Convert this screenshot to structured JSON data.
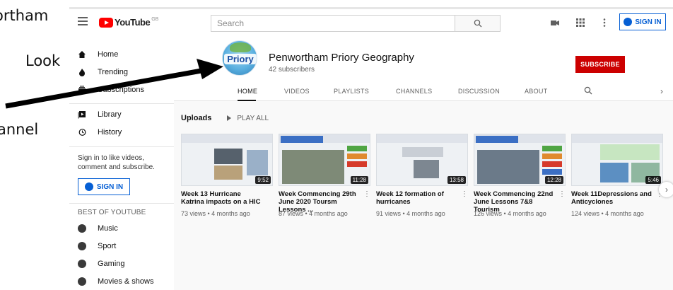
{
  "annotations": {
    "line1": "ortham",
    "line2": "Look",
    "line3": "annel"
  },
  "header": {
    "logo_text": "YouTube",
    "logo_region": "GB",
    "search_placeholder": "Search",
    "signin_label": "SIGN IN"
  },
  "sidebar": {
    "items": [
      {
        "label": "Home",
        "icon": "home-icon"
      },
      {
        "label": "Trending",
        "icon": "trending-icon"
      },
      {
        "label": "Subscriptions",
        "icon": "subscriptions-icon"
      },
      {
        "label": "Library",
        "icon": "library-icon"
      },
      {
        "label": "History",
        "icon": "history-icon"
      }
    ],
    "signin_prompt": "Sign in to like videos, comment and subscribe.",
    "signin_label": "SIGN IN",
    "best_heading": "BEST OF YOUTUBE",
    "best_items": [
      {
        "label": "Music",
        "icon": "music-icon"
      },
      {
        "label": "Sport",
        "icon": "sport-icon"
      },
      {
        "label": "Gaming",
        "icon": "gaming-icon"
      },
      {
        "label": "Movies & shows",
        "icon": "movies-icon"
      }
    ]
  },
  "channel": {
    "avatar_text": "Priory",
    "name": "Penwortham Priory Geography",
    "subscribers": "42 subscribers",
    "subscribe_label": "SUBSCRIBE",
    "tabs": [
      "HOME",
      "VIDEOS",
      "PLAYLISTS",
      "CHANNELS",
      "DISCUSSION",
      "ABOUT"
    ],
    "active_tab": "HOME"
  },
  "uploads": {
    "title": "Uploads",
    "play_all": "PLAY ALL",
    "videos": [
      {
        "title": "Week 13 Hurricane Katrina impacts on a HIC",
        "meta": "73 views • 4 months ago",
        "duration": "9:52"
      },
      {
        "title": "Week Commencing 29th June 2020 Toursm Lessons ...",
        "meta": "87 views • 4 months ago",
        "duration": "11:28"
      },
      {
        "title": "Week 12 formation of hurricanes",
        "meta": "91 views • 4 months ago",
        "duration": "13:58"
      },
      {
        "title": "Week Commencing 22nd June Lessons 7&8 Tourism",
        "meta": "126 views • 4 months ago",
        "duration": "12:28"
      },
      {
        "title": "Week 11Depressions and Anticyclones",
        "meta": "124 views • 4 months ago",
        "duration": "5:46"
      }
    ]
  },
  "colors": {
    "accent": "#065fd4",
    "subscribe": "#cc0000",
    "logo": "#ff0000"
  }
}
